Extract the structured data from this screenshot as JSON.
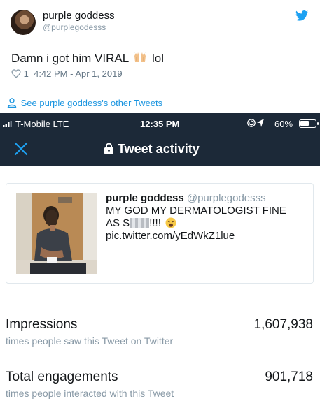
{
  "embed": {
    "display_name": "purple goddess",
    "handle": "@purplegodesss",
    "tweet_before": "Damn i got him VIRAL",
    "tweet_after": "lol",
    "like_count": "1",
    "timestamp": "4:42 PM - Apr 1, 2019",
    "other_tweets_link": "See purple goddess's other Tweets"
  },
  "status_bar": {
    "carrier": "T-Mobile  LTE",
    "time": "12:35 PM",
    "battery": "60%",
    "battery_level": 0.6
  },
  "nav": {
    "title": "Tweet activity"
  },
  "tweet_card": {
    "name": "purple goddess",
    "handle": "@purplegodesss",
    "text_line1": "MY GOD MY DERMATOLOGIST FINE",
    "text_prefix": "AS S",
    "text_suffix": "!!!!",
    "link": "pic.twitter.com/yEdWkZ1lue"
  },
  "stats": [
    {
      "label": "Impressions",
      "sublabel": "times people saw this Tweet on Twitter",
      "value": "1,607,938"
    },
    {
      "label": "Total engagements",
      "sublabel": "times people interacted with this Tweet",
      "value": "901,718"
    }
  ],
  "colors": {
    "twitter_blue": "#1da1f2",
    "link_blue": "#1b95e0",
    "nav_bg": "#1c2938",
    "muted_text": "#8899a6"
  },
  "icons": [
    "twitter-bird-icon",
    "raising-hands-emoji",
    "heart-icon",
    "person-icon",
    "signal-icon",
    "location-arrow-icon",
    "battery-icon",
    "close-icon",
    "lock-icon",
    "weary-face-emoji"
  ]
}
